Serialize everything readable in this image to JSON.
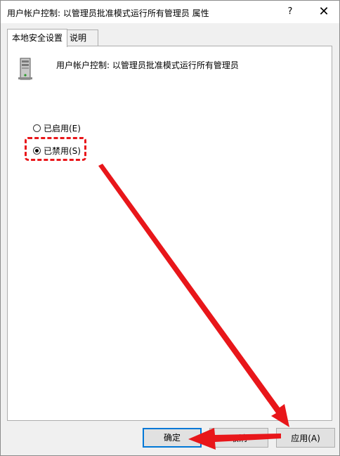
{
  "window": {
    "title": "用户帐户控制: 以管理员批准模式运行所有管理员 属性",
    "help_glyph": "?",
    "close_glyph": "✕"
  },
  "tabs": [
    {
      "label": "本地安全设置",
      "active": true
    },
    {
      "label": "说明",
      "active": false
    }
  ],
  "policy": {
    "title": "用户帐户控制: 以管理员批准模式运行所有管理员",
    "icon": "server-icon"
  },
  "options": [
    {
      "label": "已启用(E)",
      "checked": false
    },
    {
      "label": "已禁用(S)",
      "checked": true
    }
  ],
  "buttons": {
    "ok": "确定",
    "cancel": "取消",
    "apply": "应用(A)"
  },
  "annotation_color": "#e8161a"
}
